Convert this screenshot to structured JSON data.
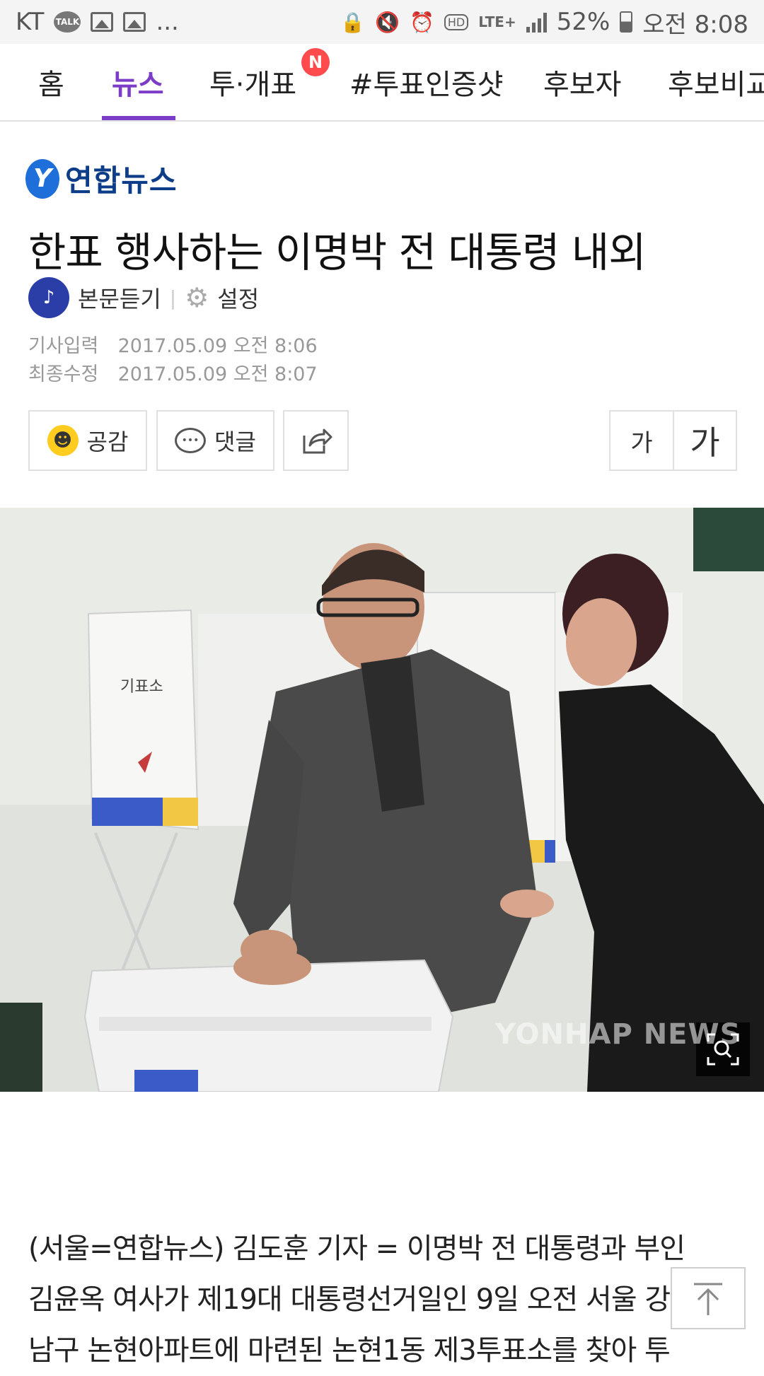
{
  "status_bar": {
    "carrier": "KT",
    "talk_label": "TALK",
    "more": "...",
    "battery": "52%",
    "time": "오전 8:08"
  },
  "tabs": [
    {
      "label": "홈"
    },
    {
      "label": "뉴스"
    },
    {
      "label": "투·개표",
      "badge": "N"
    },
    {
      "label": "#투표인증샷"
    },
    {
      "label": "후보자"
    },
    {
      "label": "후보비교"
    }
  ],
  "article": {
    "press": "연합뉴스",
    "title": "한표 행사하는 이명박 전 대통령 내외",
    "listen_label": "본문듣기",
    "settings_label": "설정",
    "input_label": "기사입력",
    "input_date": "2017.05.09 오전 8:06",
    "modified_label": "최종수정",
    "modified_date": "2017.05.09 오전 8:07",
    "like_label": "공감",
    "comment_label": "댓글",
    "font_small": "가",
    "font_large": "가",
    "photo_watermark": "YONHAP NEWS",
    "booth_sign": "기표소",
    "body_lines": [
      "(서울=연합뉴스) 김도훈 기자 = 이명박 전 대통령과 부인",
      "김윤옥 여사가 제19대 대통령선거일인 9일 오전 서울 강",
      "남구 논현아파트에 마련된 논현1동 제3투표소를 찾아 투"
    ]
  },
  "colors": {
    "accent": "#7b3cc8",
    "badge": "#ff4b4b",
    "press_blue": "#0d3c88"
  }
}
